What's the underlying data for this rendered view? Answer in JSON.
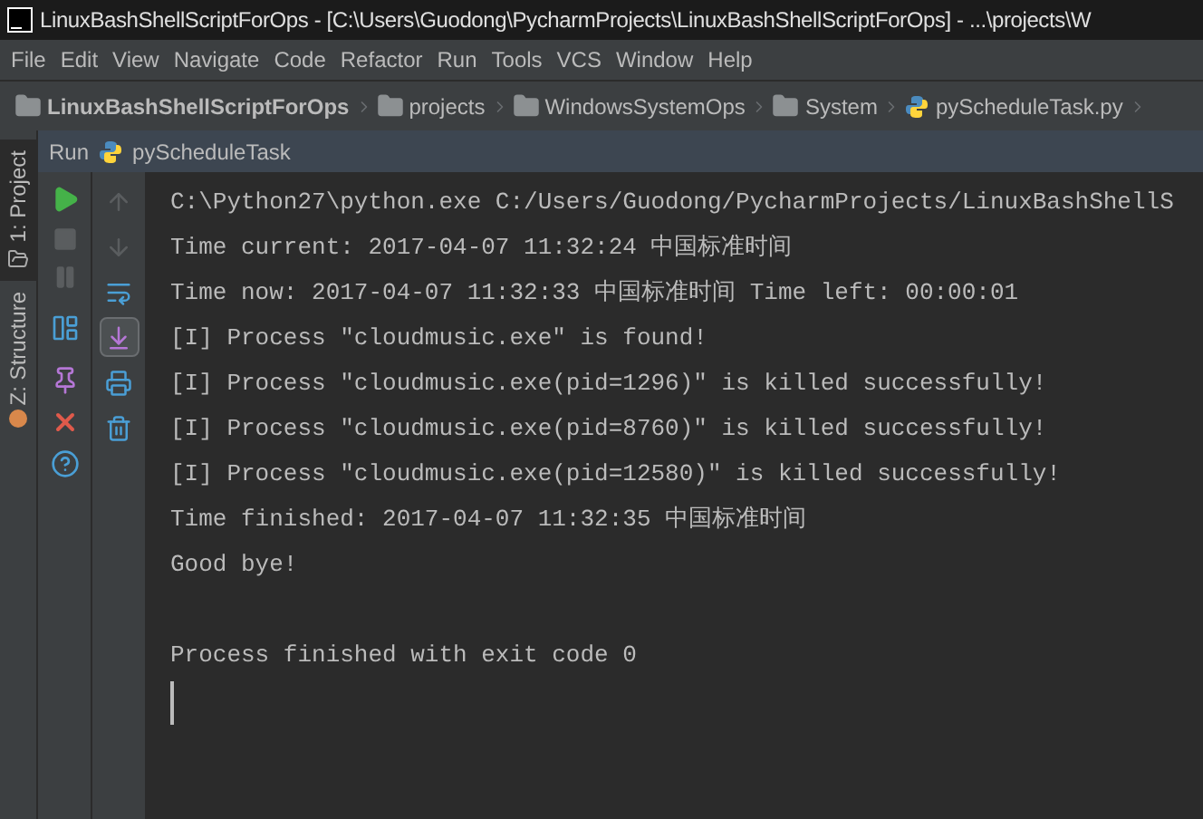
{
  "window": {
    "title": "LinuxBashShellScriptForOps - [C:\\Users\\Guodong\\PycharmProjects\\LinuxBashShellScriptForOps] - ...\\projects\\W"
  },
  "menu": [
    "File",
    "Edit",
    "View",
    "Navigate",
    "Code",
    "Refactor",
    "Run",
    "Tools",
    "VCS",
    "Window",
    "Help"
  ],
  "breadcrumbs": [
    {
      "label": "LinuxBashShellScriptForOps",
      "kind": "root"
    },
    {
      "label": "projects",
      "kind": "folder"
    },
    {
      "label": "WindowsSystemOps",
      "kind": "folder"
    },
    {
      "label": "System",
      "kind": "folder"
    },
    {
      "label": "pyScheduleTask.py",
      "kind": "file"
    }
  ],
  "side_tabs": [
    {
      "label": "1: Project",
      "selected": true
    },
    {
      "label": "Z: Structure",
      "selected": false
    }
  ],
  "run_panel": {
    "label": "Run",
    "config": "pyScheduleTask"
  },
  "console_toolbar": [
    {
      "kind": "up",
      "selected": false
    },
    {
      "kind": "down",
      "selected": false
    },
    {
      "kind": "wrap",
      "selected": false
    },
    {
      "kind": "scroll-end",
      "selected": true
    },
    {
      "kind": "print",
      "selected": false
    },
    {
      "kind": "trash",
      "selected": false
    }
  ],
  "console_lines": [
    {
      "kind": "output",
      "text": "C:\\Python27\\python.exe C:/Users/Guodong/PycharmProjects/LinuxBashShellS"
    },
    {
      "kind": "output",
      "text": "Time current: 2017-04-07 11:32:24 中国标准时间"
    },
    {
      "kind": "output",
      "text": "Time now: 2017-04-07 11:32:33 中国标准时间 Time left: 00:00:01"
    },
    {
      "kind": "output",
      "text": "[I] Process \"cloudmusic.exe\" is found!"
    },
    {
      "kind": "output",
      "text": "[I] Process \"cloudmusic.exe(pid=1296)\" is killed successfully!"
    },
    {
      "kind": "output",
      "text": "[I] Process \"cloudmusic.exe(pid=8760)\" is killed successfully!"
    },
    {
      "kind": "output",
      "text": "[I] Process \"cloudmusic.exe(pid=12580)\" is killed successfully!"
    },
    {
      "kind": "output",
      "text": "Time finished: 2017-04-07 11:32:35 中国标准时间"
    },
    {
      "kind": "output",
      "text": "Good bye!"
    },
    {
      "kind": "blank"
    },
    {
      "kind": "output",
      "text": "Process finished with exit code 0"
    }
  ]
}
